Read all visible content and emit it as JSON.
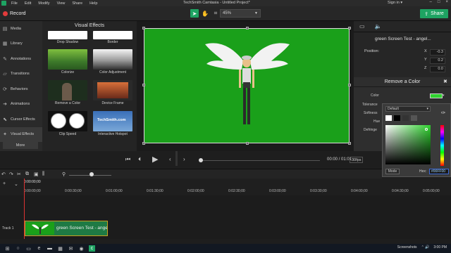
{
  "window": {
    "title": "TechSmith Camtasia - Untitled Project*",
    "menu": [
      "File",
      "Edit",
      "Modify",
      "View",
      "Share",
      "Help"
    ],
    "signin": "Sign in",
    "controls": [
      "–",
      "□",
      "×"
    ]
  },
  "toolbar": {
    "record_label": "Record",
    "zoom_value": "45%",
    "share_label": "Share",
    "tools": [
      {
        "name": "select-arrow-icon",
        "glyph": "➤"
      },
      {
        "name": "pan-hand-icon",
        "glyph": "✋"
      },
      {
        "name": "crop-icon",
        "glyph": "⌗"
      }
    ]
  },
  "sidebar": {
    "items": [
      {
        "label": "Media",
        "icon": "media-icon",
        "glyph": "▤"
      },
      {
        "label": "Library",
        "icon": "library-icon",
        "glyph": "▦"
      },
      {
        "label": "Annotations",
        "icon": "annotations-icon",
        "glyph": "✎"
      },
      {
        "label": "Transitions",
        "icon": "transitions-icon",
        "glyph": "▱"
      },
      {
        "label": "Behaviors",
        "icon": "behaviors-icon",
        "glyph": "⟳"
      },
      {
        "label": "Animations",
        "icon": "animations-icon",
        "glyph": "➜"
      },
      {
        "label": "Cursor Effects",
        "icon": "cursor-icon",
        "glyph": "⬉"
      },
      {
        "label": "Visual Effects",
        "icon": "visual-effects-icon",
        "glyph": "✦"
      }
    ],
    "more_label": "More"
  },
  "effects": {
    "title": "Visual Effects",
    "items": [
      {
        "label": "Drop Shadow",
        "colors": [
          "#ffffff",
          "#cccccc"
        ]
      },
      {
        "label": "Border",
        "colors": [
          "#ffffff",
          "#dddddd"
        ]
      },
      {
        "label": "Colorize",
        "colors": [
          "#3f8f2f",
          "#a6cf53"
        ]
      },
      {
        "label": "Color Adjustment",
        "colors": [
          "#f2f2f2",
          "#2b2b2b"
        ]
      },
      {
        "label": "Remove a Color",
        "colors": [
          "#2d4a2d",
          "#6b5a4a"
        ]
      },
      {
        "label": "Device Frame",
        "colors": [
          "#8a3a2a",
          "#d8703a"
        ]
      },
      {
        "label": "Clip Speed",
        "colors": [
          "#ffffff",
          "#f2f2f2"
        ]
      },
      {
        "label": "Interactive Hotspot",
        "colors": [
          "#1e5aa8",
          "#4a90d9"
        ]
      }
    ],
    "hotspot_text": "TechSmith.com"
  },
  "playback": {
    "time": "00:00 / 01:01",
    "fps": "30fps",
    "progress": 0.0
  },
  "properties": {
    "clip_name": "green Screen Test - angel...",
    "position_label": "Position:",
    "x_label": "X",
    "x_value": "-0.3",
    "y_label": "Y",
    "y_value": "0.2",
    "z_label": "Z",
    "z_value": "0.0"
  },
  "remove_color": {
    "title": "Remove a Color",
    "color_label": "Color",
    "tolerance_label": "Tolerance",
    "softness_label": "Softness",
    "hue_label": "Hue",
    "defringe_label": "Defringe",
    "color_value": "#2fd22f"
  },
  "picker": {
    "preset": "Default",
    "mode_label": "Mode",
    "hex_label": "Hex:",
    "hex_value": "#00FF00",
    "swatches": [
      "#ffffff",
      "#000000",
      "#333333",
      "#555555"
    ]
  },
  "timeline": {
    "zoom_level": 0.5,
    "playhead_time": "0:00:00;00",
    "ticks": [
      "0:00:00;00",
      "0:00:30;00",
      "0:01:00;00",
      "0:01:30;00",
      "0:02:00;00",
      "0:02:30;00",
      "0:03:00;00",
      "0:03:30;00",
      "0:04:00;00",
      "0:04:30;00",
      "0:05:00;00",
      "0:05:30;00"
    ],
    "track_label": "Track 1",
    "clip_title": "green Screen Test - angel"
  },
  "taskbar": {
    "screenshots_label": "Screenshots",
    "time": "3:00 PM"
  },
  "colors": {
    "accent": "#1ea362",
    "green_screen": "#1aa01a",
    "record": "#e23b3b",
    "playhead": "#dd3333"
  }
}
